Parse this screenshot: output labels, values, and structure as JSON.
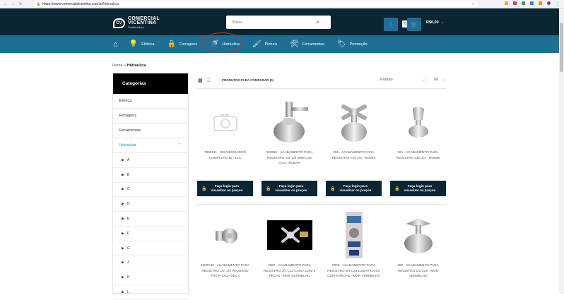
{
  "browser": {
    "url_host": "https://www.comercialvicentina.com.br/",
    "url_path": "hidraulica",
    "ext_colors": [
      "#f5a623",
      "#e53935",
      "#43a047",
      "#1e88e5",
      "#fb8c00",
      "#8e24aa"
    ]
  },
  "header": {
    "logo_line1": "COMERCIAL",
    "logo_line2": "VICENTINA",
    "logo_line3": "Distribuidora",
    "search_placeholder": "Busca",
    "cart_count": "0",
    "cart_total": "R$0,00"
  },
  "nav": {
    "items": [
      {
        "label": "Elétrica",
        "icon": "lightbulb-icon",
        "glyph": "💡"
      },
      {
        "label": "Ferragens",
        "icon": "padlock-icon",
        "glyph": "🔒"
      },
      {
        "label": "Hidráulica",
        "icon": "faucet-icon",
        "glyph": "🚿"
      },
      {
        "label": "Pintura",
        "icon": "paint-roller-icon",
        "glyph": "🖌"
      },
      {
        "label": "Ferramentas",
        "icon": "tools-icon",
        "glyph": "🛠"
      },
      {
        "label": "Promoção",
        "icon": "tag-icon",
        "glyph": "🏷"
      }
    ],
    "highlight_color": "#c0392b"
  },
  "breadcrumb": {
    "home": "Home",
    "sep": " » ",
    "current": "Hidráulica"
  },
  "sidebar": {
    "title": "Categorias",
    "categories": [
      "Elétrica",
      "Ferragens",
      "Ferramentas"
    ],
    "active": "Hidráulica",
    "subcategories": [
      "A",
      "B",
      "C",
      "D",
      "E",
      "F",
      "G",
      "J",
      "K",
      "L"
    ]
  },
  "toolbar": {
    "compare_label": "PRODUTOS PARA COMPARAR (0)",
    "sort_value": "Padrão",
    "per_page": "60"
  },
  "login_label_1": "Faça login para",
  "login_label_2": "visualizar os preços",
  "products": [
    {
      "name": "7585211 - 006 DESVIADOR COMPLETO 10 - LLC"
    },
    {
      "name": "303850 - ACABAMENTO PARA REGISTRO 1/2 ,3/4 4900 C10 C/12- HIOBAN"
    },
    {
      "name": "255 - ACABAMENTO PARA REGISTRO C33 1/2 - ROMIS"
    },
    {
      "name": "261 - ACABAMENTO PARA REGISTRO C50 1/2 - ROMIS"
    },
    {
      "name": "4900C50 - ACABAMENTO PARA REGISTRO 1/2 ,3/4 PEQUENO PRATA C/12- DECA"
    },
    {
      "name": "0060 - ACABAMENTO PARA REGISTRO 3/4 C22 CAIXA COM 6 PECAS - MAR VERMELHO"
    },
    {
      "name": "0060 - ACABAMENTO PARA REGISTRO 3/4 C23 LUGHT CAIXA COM 6 PECAS - MOR VERMELHO"
    },
    {
      "name": "350 - ACABAMENTO PARA REGISTRO 1/2 C25 - MOR VERMELHO"
    }
  ]
}
